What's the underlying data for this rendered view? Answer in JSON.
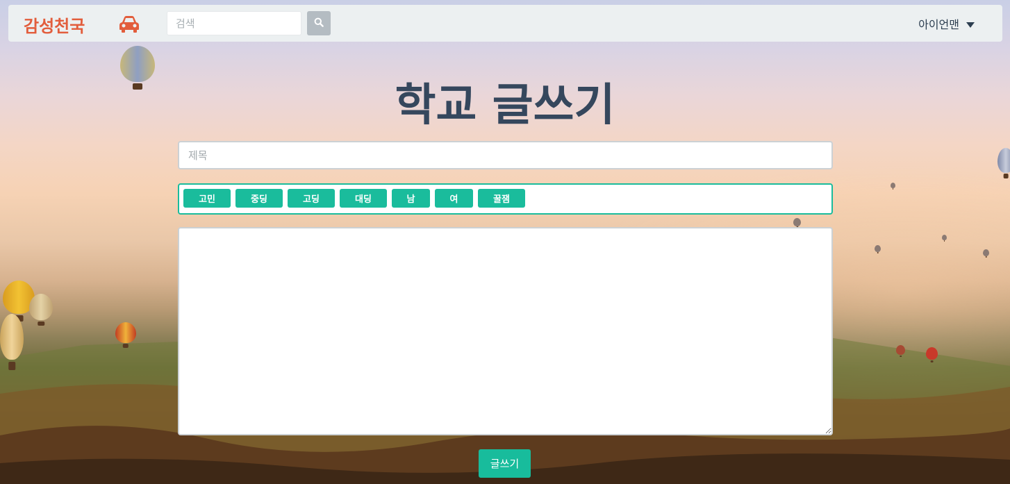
{
  "navbar": {
    "brand": "감성천국",
    "search_placeholder": "검색",
    "user_name": "아이언맨"
  },
  "icons": {
    "car": "car-icon",
    "search": "search-icon",
    "caret": "caret-down-icon"
  },
  "form": {
    "heading": "학교 글쓰기",
    "title_placeholder": "제목",
    "tags": [
      "고민",
      "중딩",
      "고딩",
      "대딩",
      "남",
      "여",
      "꿀잼"
    ],
    "submit_label": "글쓰기"
  },
  "colors": {
    "brand": "#e25d3c",
    "accent": "#1abc9c",
    "heading": "#35475d",
    "navbar_bg": "#ecf0f1"
  }
}
